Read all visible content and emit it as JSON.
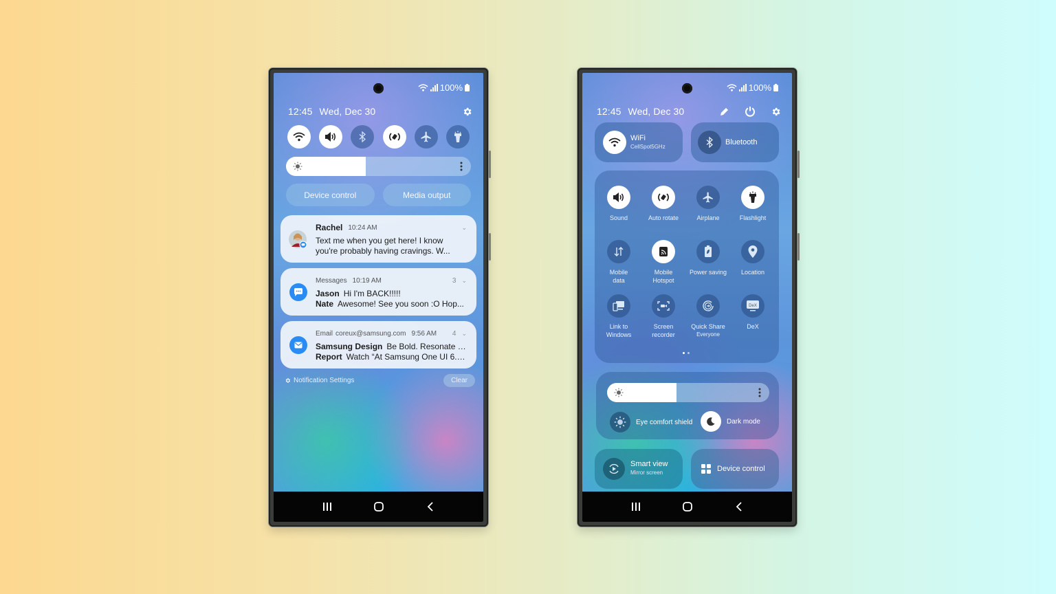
{
  "background": {
    "left_color": "#fcd890",
    "right_color": "#cffcfd"
  },
  "status_bar": {
    "battery": "100%"
  },
  "left_phone": {
    "time": "12:45",
    "date": "Wed, Dec 30",
    "quick_toggles": [
      {
        "name": "wifi",
        "state": "on"
      },
      {
        "name": "sound",
        "state": "on"
      },
      {
        "name": "bluetooth",
        "state": "off"
      },
      {
        "name": "auto-rotate",
        "state": "on"
      },
      {
        "name": "airplane",
        "state": "off"
      },
      {
        "name": "flashlight",
        "state": "off"
      }
    ],
    "brightness_level": 0.43,
    "buttons": {
      "device_control": "Device control",
      "media_output": "Media output"
    },
    "notifications": [
      {
        "sender": "Rachel",
        "time": "10:24 AM",
        "text1": "Text me when you get here! I know",
        "text2": "you're probably having cravings. W..."
      },
      {
        "app": "Messages",
        "time": "10:19 AM",
        "count": "3",
        "lines": [
          {
            "from": "Jason",
            "text": "Hi I'm BACK!!!!!"
          },
          {
            "from": "Nate",
            "text": "Awesome! See you soon :O Hop..."
          }
        ]
      },
      {
        "app": "Email",
        "account": "coreux@samsung.com",
        "time": "9:56 AM",
        "count": "4",
        "lines": [
          {
            "from": "Samsung Design",
            "text": "Be Bold. Resonate w..."
          },
          {
            "from": "Report",
            "text": "Watch “At Samsung One UI 6.0..."
          }
        ]
      }
    ],
    "notification_settings": "Notification Settings",
    "clear": "Clear"
  },
  "right_phone": {
    "time": "12:45",
    "date": "Wed, Dec 30",
    "wifi_tile": {
      "label": "WiFi",
      "sub": "CellSpot5GHz"
    },
    "bluetooth_tile": {
      "label": "Bluetooth"
    },
    "grid": [
      {
        "label": "Sound",
        "state": "on"
      },
      {
        "label": "Auto rotate",
        "state": "on"
      },
      {
        "label": "Airplane",
        "state": "off"
      },
      {
        "label": "Flashlight",
        "state": "on"
      },
      {
        "label": "Mobile",
        "label2": "data",
        "state": "off"
      },
      {
        "label": "Mobile",
        "label2": "Hotspot",
        "state": "on"
      },
      {
        "label": "Power saving",
        "state": "off"
      },
      {
        "label": "Location",
        "state": "off"
      },
      {
        "label": "Link to",
        "label2": "Windows",
        "state": "off"
      },
      {
        "label": "Screen",
        "label2": "recorder",
        "state": "off"
      },
      {
        "label": "Quick Share",
        "sub": "Everyone",
        "state": "off"
      },
      {
        "label": "DeX",
        "state": "off"
      }
    ],
    "page_indicator": {
      "pages": 2,
      "current": 1
    },
    "brightness_level": 0.43,
    "eye_comfort": "Eye comfort shield",
    "dark_mode": "Dark mode",
    "smart_view": {
      "label": "Smart view",
      "sub": "Mirror screen"
    },
    "device_control": "Device control"
  }
}
